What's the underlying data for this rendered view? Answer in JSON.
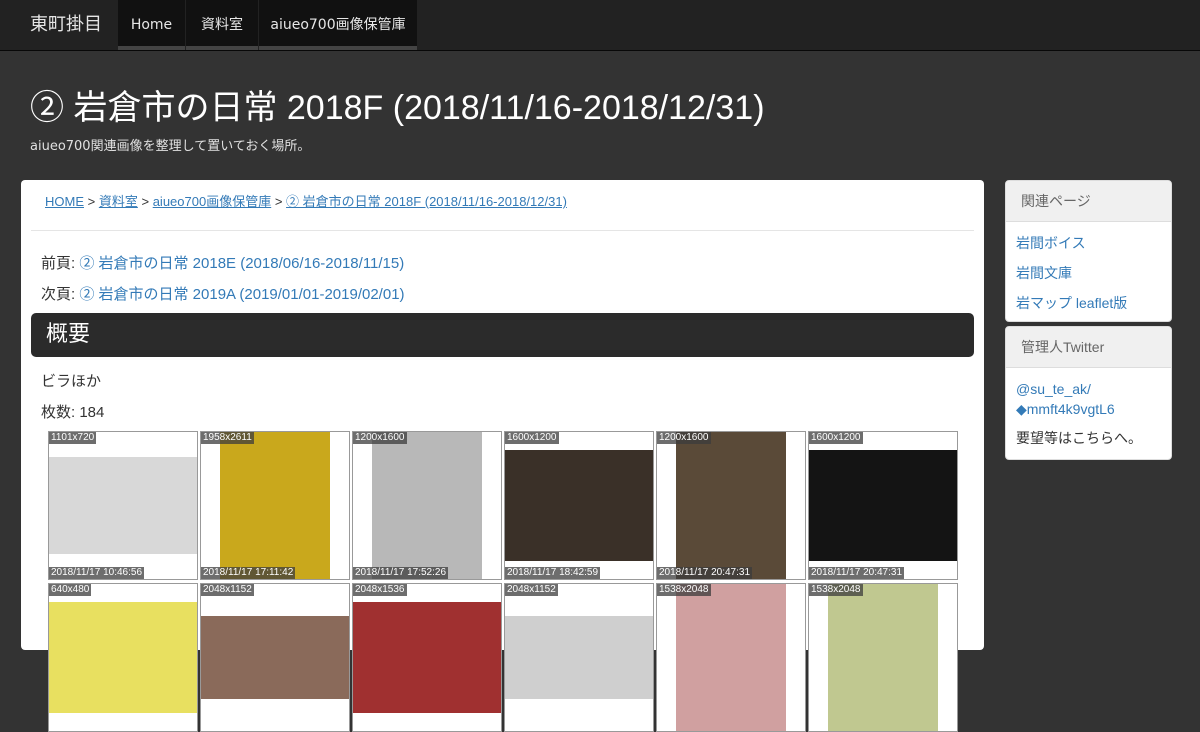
{
  "nav": {
    "brand": "東町掛目",
    "tabs": [
      "Home",
      "資料室",
      "aiueo700画像保管庫"
    ]
  },
  "header": {
    "title": "② 岩倉市の日常 2018F (2018/11/16-2018/12/31)",
    "subtitle": "aiueo700関連画像を整理して置いておく場所。"
  },
  "breadcrumb": {
    "items": [
      "HOME",
      "資料室",
      "aiueo700画像保管庫",
      "② 岩倉市の日常 2018F (2018/11/16-2018/12/31)"
    ],
    "sep": ">"
  },
  "pager": {
    "prev_label": "前頁:",
    "prev_link": "② 岩倉市の日常 2018E (2018/06/16-2018/11/15)",
    "next_label": "次頁:",
    "next_link": "② 岩倉市の日常 2019A (2019/01/01-2019/02/01)"
  },
  "overview": {
    "heading": "概要",
    "description": "ビラほか",
    "count_label": "枚数: 184"
  },
  "thumbnails": [
    {
      "size": "1101x720",
      "date": "2018/11/17 10:46:56",
      "color": "#d8d8d8"
    },
    {
      "size": "1958x2611",
      "date": "2018/11/17 17:11:42",
      "color": "#c9a81c"
    },
    {
      "size": "1200x1600",
      "date": "2018/11/17 17:52:26",
      "color": "#b8b8b8"
    },
    {
      "size": "1600x1200",
      "date": "2018/11/17 18:42:59",
      "color": "#3a3028"
    },
    {
      "size": "1200x1600",
      "date": "2018/11/17 20:47:31",
      "color": "#5a4a38"
    },
    {
      "size": "1600x1200",
      "date": "2018/11/17 20:47:31",
      "color": "#141414"
    },
    {
      "size": "640x480",
      "date": "",
      "color": "#e8e060"
    },
    {
      "size": "2048x1152",
      "date": "",
      "color": "#8a6a5a"
    },
    {
      "size": "2048x1536",
      "date": "",
      "color": "#a03030"
    },
    {
      "size": "2048x1152",
      "date": "",
      "color": "#cfcfcf"
    },
    {
      "size": "1538x2048",
      "date": "",
      "color": "#d0a0a0"
    },
    {
      "size": "1538x2048",
      "date": "",
      "color": "#c0c890"
    }
  ],
  "sidebar": {
    "related": {
      "heading": "関連ページ",
      "links": [
        "岩間ボイス",
        "岩間文庫",
        "岩マップ leaflet版"
      ]
    },
    "admin": {
      "heading": "管理人Twitter",
      "handle": "@su_te_ak/",
      "handle2": "◆mmft4k9vgtL6",
      "note": "要望等はこちらへ。"
    }
  }
}
